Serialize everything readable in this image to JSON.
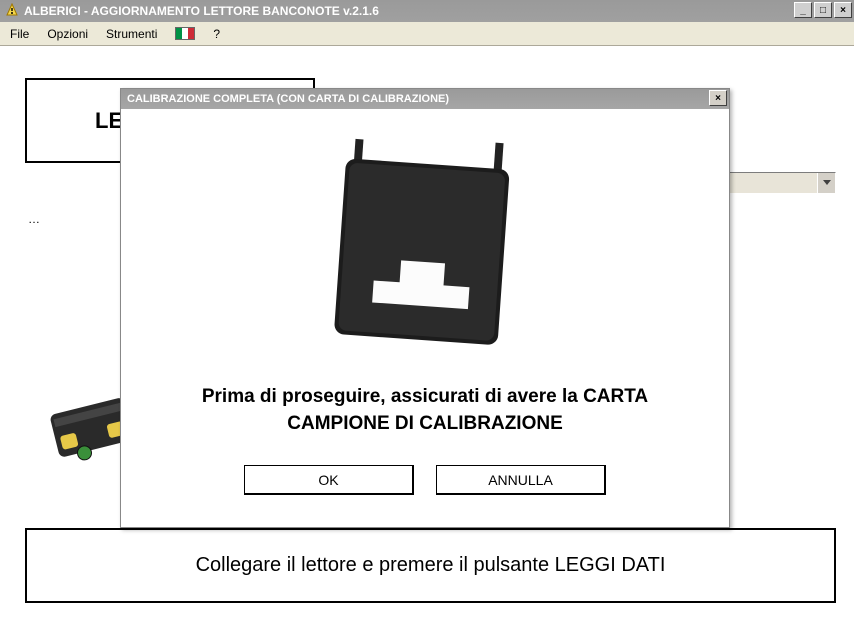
{
  "window": {
    "title": "ALBERICI - AGGIORNAMENTO LETTORE BANCONOTE v.2.1.6",
    "minimize": "_",
    "maximize": "□",
    "close": "×"
  },
  "menu": {
    "file": "File",
    "opzioni": "Opzioni",
    "strumenti": "Strumenti",
    "help": "?"
  },
  "main": {
    "le_label": "LE",
    "dotted": "…",
    "status": "Collegare il lettore e premere il pulsante LEGGI DATI"
  },
  "dialog": {
    "title": "CALIBRAZIONE COMPLETA (CON CARTA DI CALIBRAZIONE)",
    "close": "×",
    "message_line1": "Prima di proseguire, assicurati di avere la CARTA",
    "message_line2": "CAMPIONE DI CALIBRAZIONE",
    "ok": "OK",
    "cancel": "ANNULLA"
  }
}
